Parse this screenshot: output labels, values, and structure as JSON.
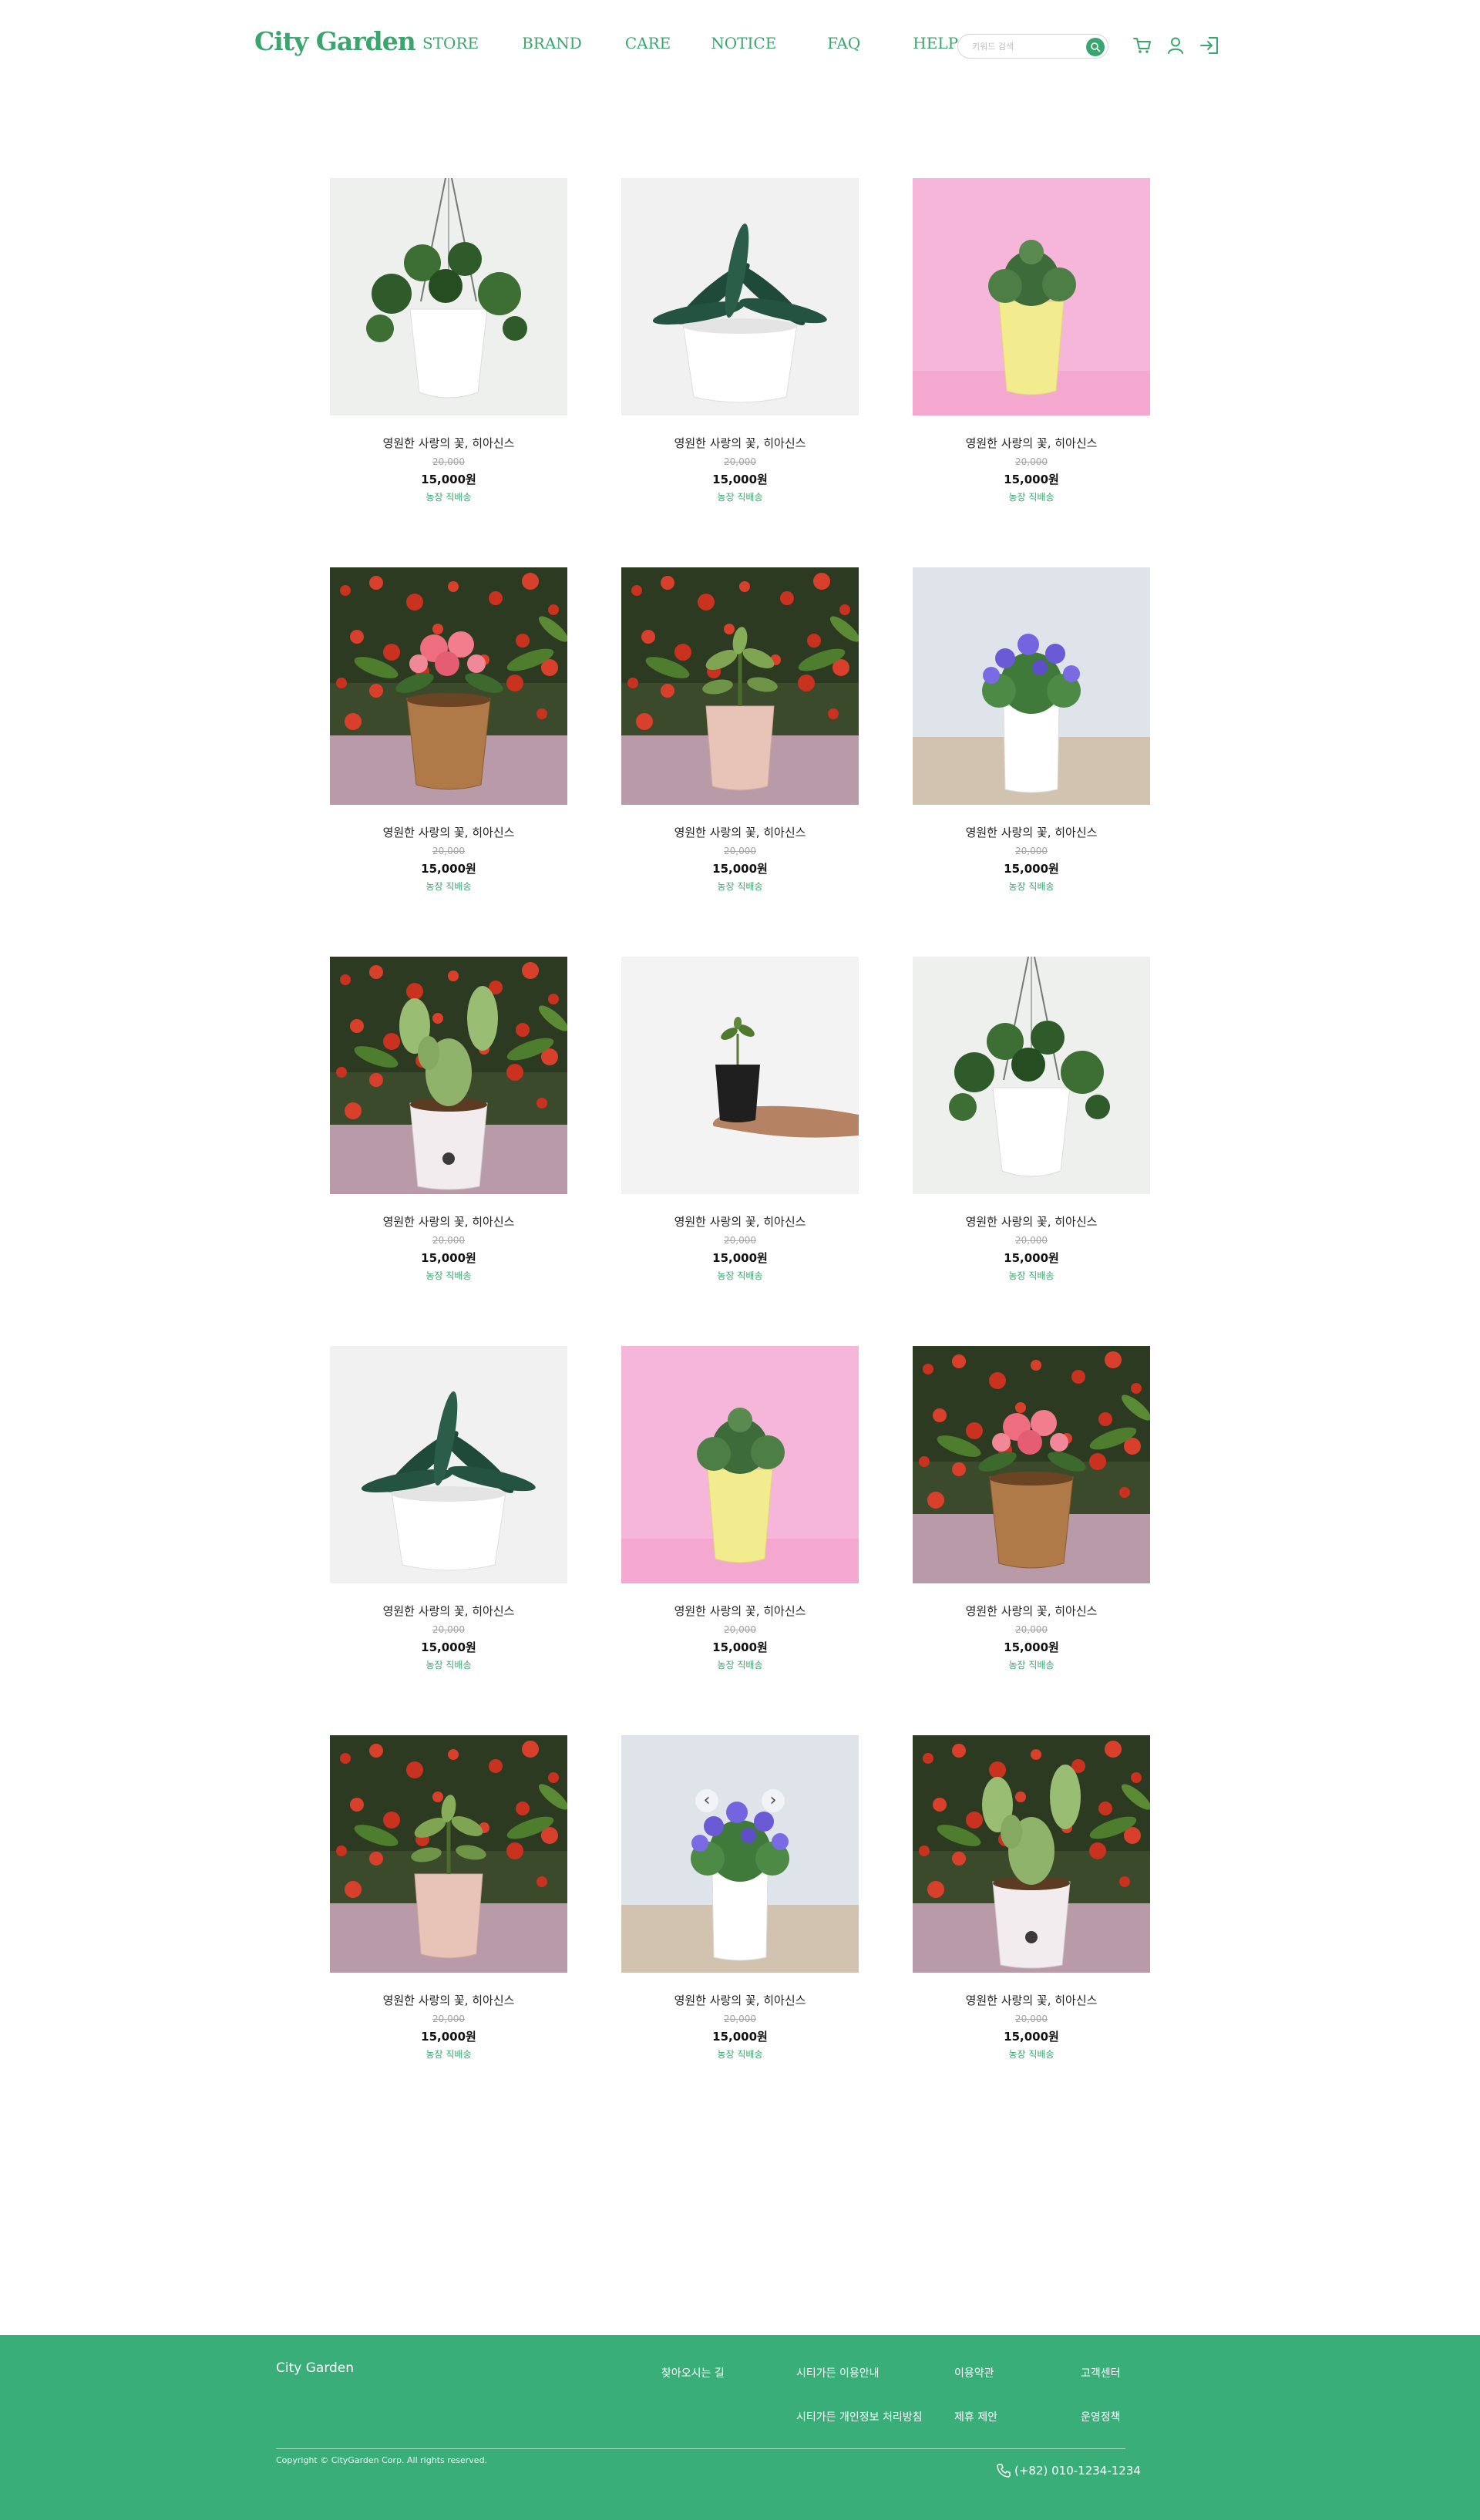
{
  "brand": {
    "name": "City Garden",
    "color": "#3aa66e"
  },
  "nav": {
    "items": [
      "STORE",
      "BRAND",
      "CARE",
      "NOTICE",
      "FAQ",
      "HELP"
    ]
  },
  "search": {
    "placeholder": "키워드 검색",
    "icon": "search-icon"
  },
  "header_icons": [
    "cart-icon",
    "user-icon",
    "login-icon"
  ],
  "products": [
    {
      "name": "영원한 사랑의 꽃, 히아신스",
      "old_price": "20,000",
      "price": "15,000원",
      "shipping": "농장 직배송",
      "image": "hanging-pilea"
    },
    {
      "name": "영원한 사랑의 꽃, 히아신스",
      "old_price": "20,000",
      "price": "15,000원",
      "shipping": "농장 직배송",
      "image": "gasteria-white-pot"
    },
    {
      "name": "영원한 사랑의 꽃, 히아신스",
      "old_price": "20,000",
      "price": "15,000원",
      "shipping": "농장 직배송",
      "image": "herb-yellow-pot-pink-bg"
    },
    {
      "name": "영원한 사랑의 꽃, 히아신스",
      "old_price": "20,000",
      "price": "15,000원",
      "shipping": "농장 직배송",
      "image": "pink-flower-clay-pot"
    },
    {
      "name": "영원한 사랑의 꽃, 히아신스",
      "old_price": "20,000",
      "price": "15,000원",
      "shipping": "농장 직배송",
      "image": "jade-pink-pot"
    },
    {
      "name": "영원한 사랑의 꽃, 히아신스",
      "old_price": "20,000",
      "price": "15,000원",
      "shipping": "농장 직배송",
      "image": "purple-flower-white-pot"
    },
    {
      "name": "영원한 사랑의 꽃, 히아신스",
      "old_price": "20,000",
      "price": "15,000원",
      "shipping": "농장 직배송",
      "image": "bunny-cactus"
    },
    {
      "name": "영원한 사랑의 꽃, 히아신스",
      "old_price": "20,000",
      "price": "15,000원",
      "shipping": "농장 직배송",
      "image": "sprout-in-hand"
    },
    {
      "name": "영원한 사랑의 꽃, 히아신스",
      "old_price": "20,000",
      "price": "15,000원",
      "shipping": "농장 직배송",
      "image": "hanging-pilea"
    },
    {
      "name": "영원한 사랑의 꽃, 히아신스",
      "old_price": "20,000",
      "price": "15,000원",
      "shipping": "농장 직배송",
      "image": "gasteria-white-pot"
    },
    {
      "name": "영원한 사랑의 꽃, 히아신스",
      "old_price": "20,000",
      "price": "15,000원",
      "shipping": "농장 직배송",
      "image": "herb-yellow-pot-pink-bg"
    },
    {
      "name": "영원한 사랑의 꽃, 히아신스",
      "old_price": "20,000",
      "price": "15,000원",
      "shipping": "농장 직배송",
      "image": "pink-flower-clay-pot"
    },
    {
      "name": "영원한 사랑의 꽃, 히아신스",
      "old_price": "20,000",
      "price": "15,000원",
      "shipping": "농장 직배송",
      "image": "jade-pink-pot"
    },
    {
      "name": "영원한 사랑의 꽃, 히아신스",
      "old_price": "20,000",
      "price": "15,000원",
      "shipping": "농장 직배송",
      "image": "purple-flower-white-pot",
      "carousel_arrows": {
        "prev": "‹",
        "next": "›"
      }
    },
    {
      "name": "영원한 사랑의 꽃, 히아신스",
      "old_price": "20,000",
      "price": "15,000원",
      "shipping": "농장 직배송",
      "image": "bunny-cactus"
    }
  ],
  "footer": {
    "logo": "City Garden",
    "links": {
      "directions": "찾아오시는 길",
      "guide": "시티가든 이용안내",
      "terms": "이용약관",
      "support": "고객센터",
      "privacy": "시티가든 개인정보 처리방침",
      "partnership": "제휴 제안",
      "policy": "운영정책"
    },
    "copyright": "Copyright © CityGarden Corp. All rights reserved.",
    "phone": "(+82) 010-1234-1234",
    "phone_icon": "phone-icon",
    "background": "#3aae78"
  }
}
